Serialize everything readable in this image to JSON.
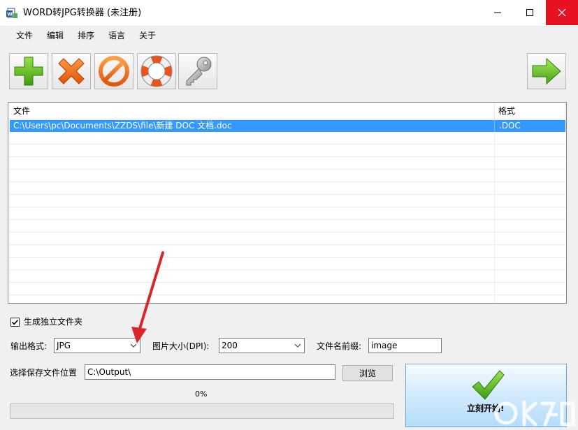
{
  "window": {
    "title": "WORD转JPG转换器 (未注册)"
  },
  "menu": {
    "items": [
      "文件",
      "编辑",
      "排序",
      "语言",
      "关于"
    ]
  },
  "toolbar": {
    "buttons": [
      "add-icon",
      "delete-icon",
      "clear-icon",
      "help-lifebuoy-icon",
      "register-key-icon",
      "next-arrow-icon"
    ]
  },
  "file_list": {
    "columns": [
      "文件",
      "格式"
    ],
    "rows": [
      {
        "path": "C:\\Users\\pc\\Documents\\ZZDS\\file\\新建 DOC 文档.doc",
        "format": ".DOC"
      }
    ]
  },
  "options": {
    "separate_folder_label": "生成独立文件夹",
    "separate_folder_checked": true,
    "output_format_label": "输出格式:",
    "output_format_value": "JPG",
    "dpi_label": "图片大小(DPI):",
    "dpi_value": "200",
    "prefix_label": "文件名前缀:",
    "prefix_value": "image",
    "save_location_label": "选择保存文件位置",
    "save_location_value": "C:\\Output\\",
    "browse_label": "浏览"
  },
  "progress": {
    "percent_text": "0%",
    "value": 0
  },
  "start_button": {
    "label": "立刻开始!"
  },
  "colors": {
    "selection": "#3399ff",
    "close_button": "#e81123",
    "annotation_arrow": "#d9262a"
  }
}
